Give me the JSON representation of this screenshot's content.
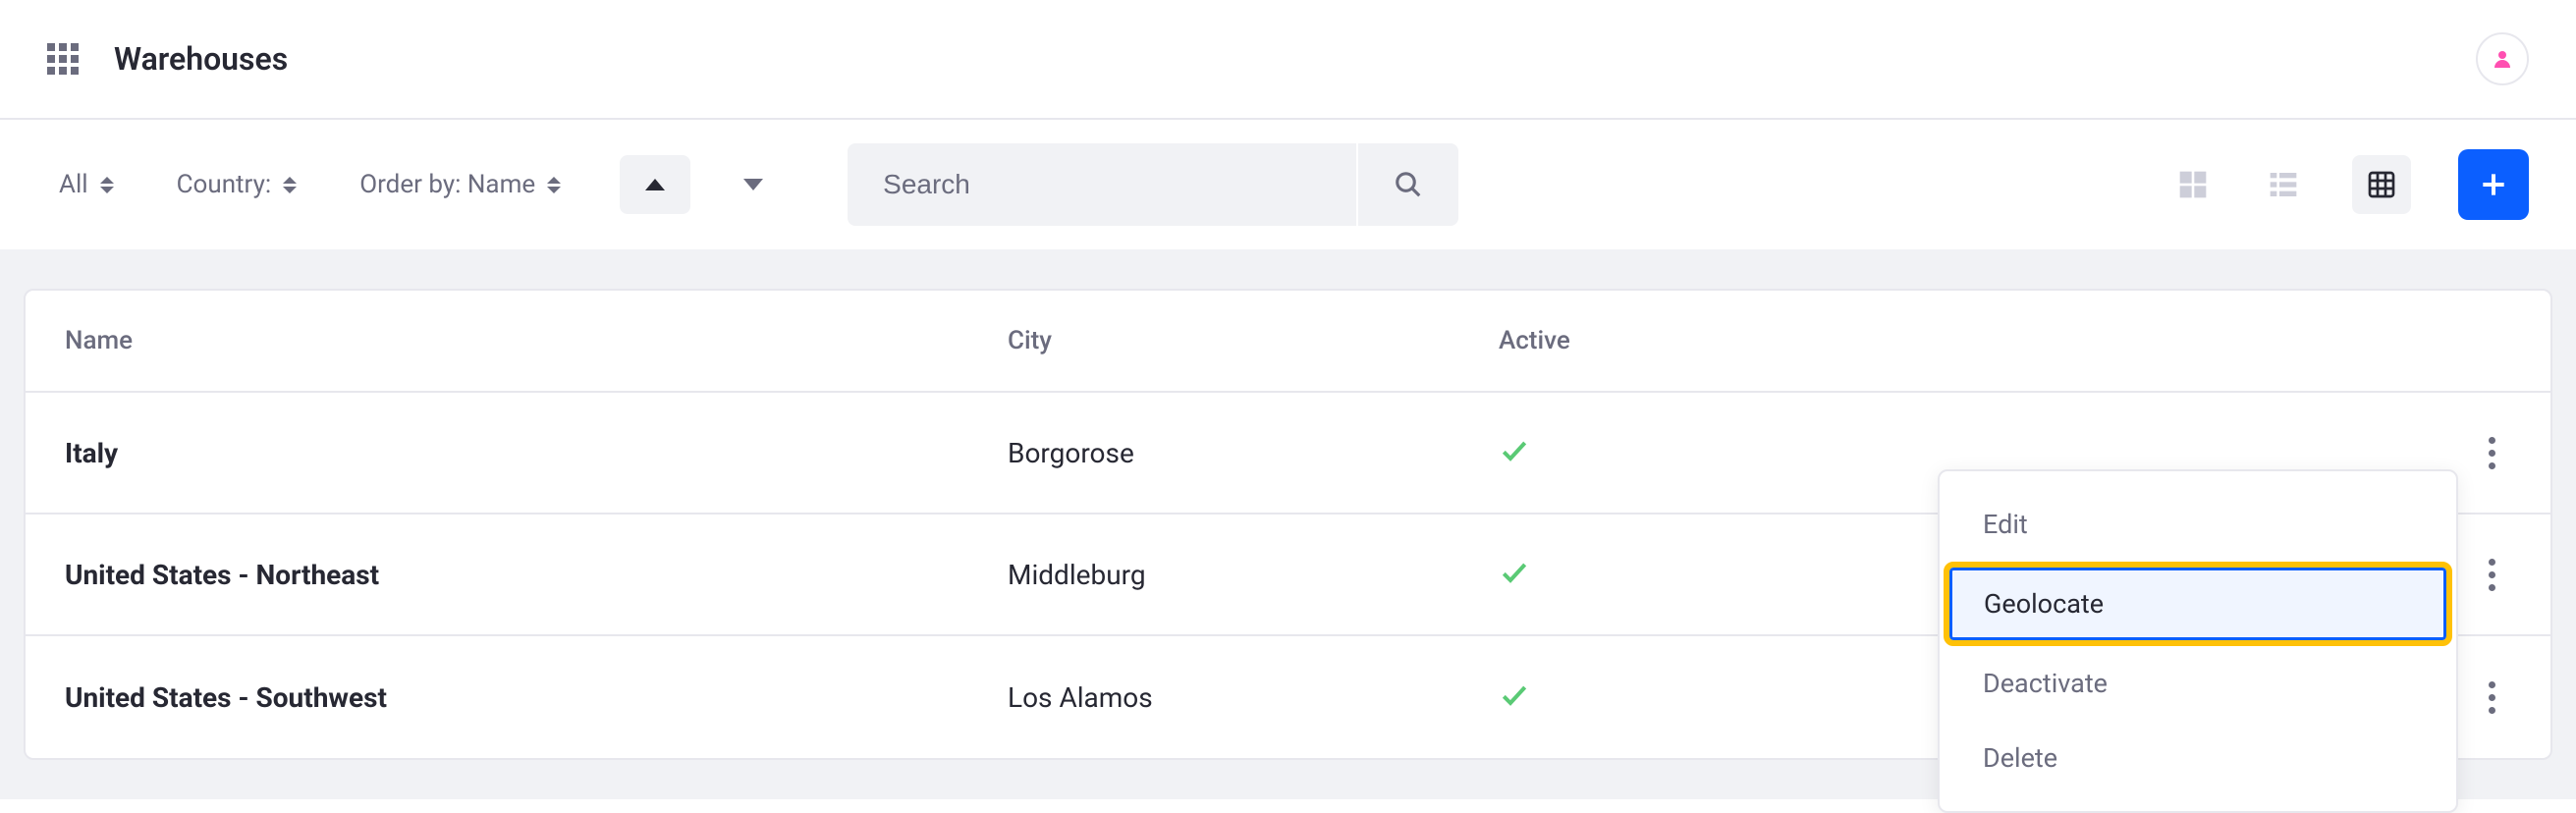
{
  "header": {
    "title": "Warehouses"
  },
  "toolbar": {
    "filters": {
      "all": "All",
      "country": "Country:",
      "order_by": "Order by: Name"
    },
    "search_placeholder": "Search"
  },
  "table": {
    "columns": {
      "name": "Name",
      "city": "City",
      "active": "Active"
    },
    "rows": [
      {
        "name": "Italy",
        "city": "Borgorose",
        "active": true
      },
      {
        "name": "United States - Northeast",
        "city": "Middleburg",
        "active": true
      },
      {
        "name": "United States - Southwest",
        "city": "Los Alamos",
        "active": true
      }
    ]
  },
  "dropdown": {
    "edit": "Edit",
    "geolocate": "Geolocate",
    "deactivate": "Deactivate",
    "delete": "Delete"
  }
}
